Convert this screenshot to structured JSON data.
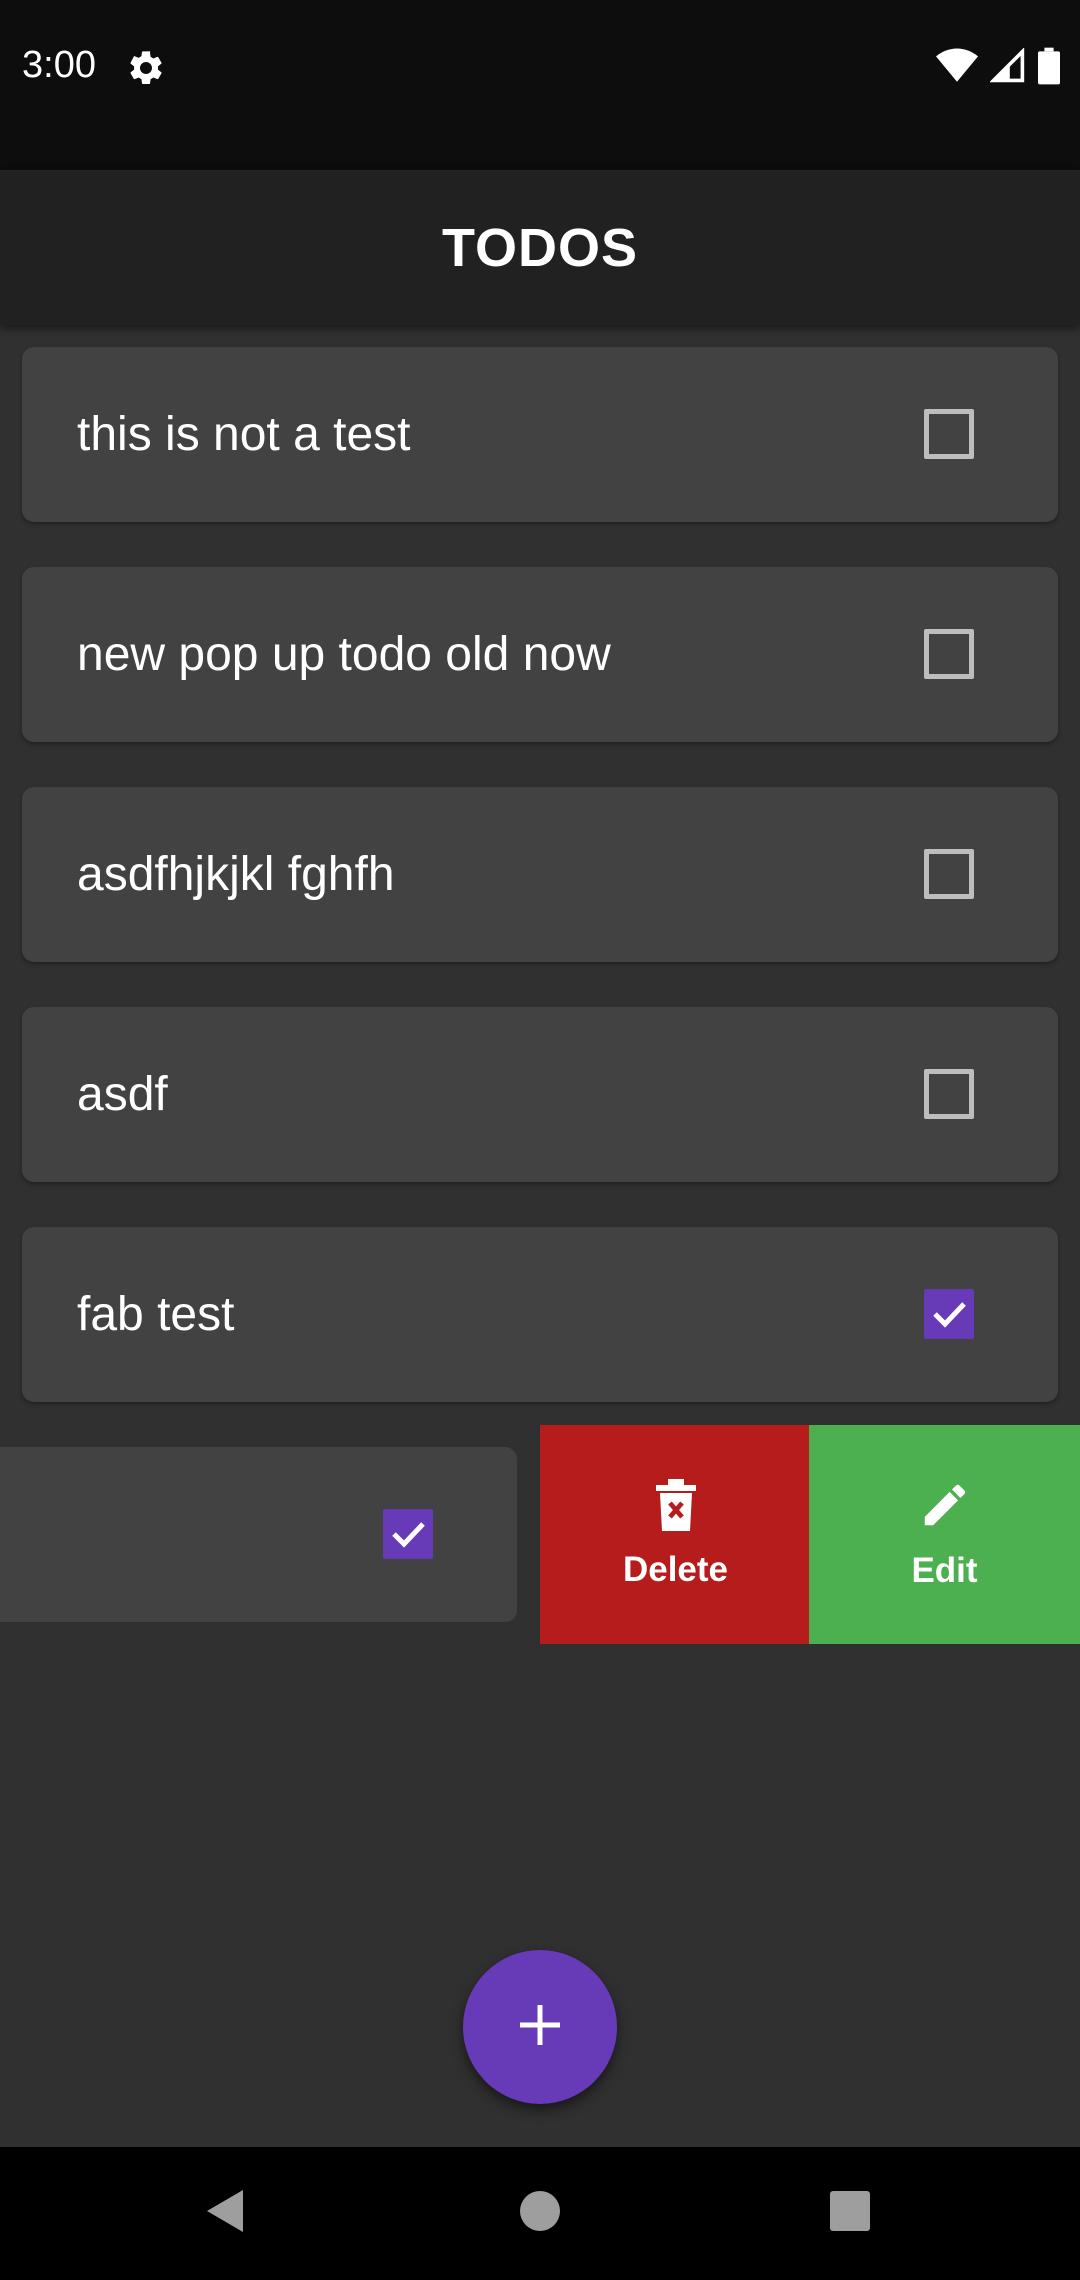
{
  "status_bar": {
    "time": "3:00",
    "icons": [
      "settings-gear-icon",
      "wifi-icon",
      "cell-signal-icon",
      "battery-icon"
    ]
  },
  "app_bar": {
    "title": "TODOS"
  },
  "todos": [
    {
      "label": "this is not a test",
      "checked": false
    },
    {
      "label": "new pop up todo old now",
      "checked": false
    },
    {
      "label": "asdfhjkjkl fghfh",
      "checked": false
    },
    {
      "label": "asdf",
      "checked": false
    },
    {
      "label": "fab test",
      "checked": true
    }
  ],
  "swiped_todo": {
    "label": "",
    "checked": true
  },
  "swipe_actions": {
    "delete_label": "Delete",
    "edit_label": "Edit",
    "delete_icon": "delete-icon",
    "edit_icon": "pencil-icon"
  },
  "fab": {
    "icon": "plus-icon"
  },
  "nav_bar": {
    "icons": [
      "back-icon",
      "home-icon",
      "recents-icon"
    ]
  },
  "colors": {
    "accent": "#673ab7",
    "delete": "#b71c1c",
    "edit": "#4caf50",
    "card": "#424242",
    "background": "#303030"
  }
}
